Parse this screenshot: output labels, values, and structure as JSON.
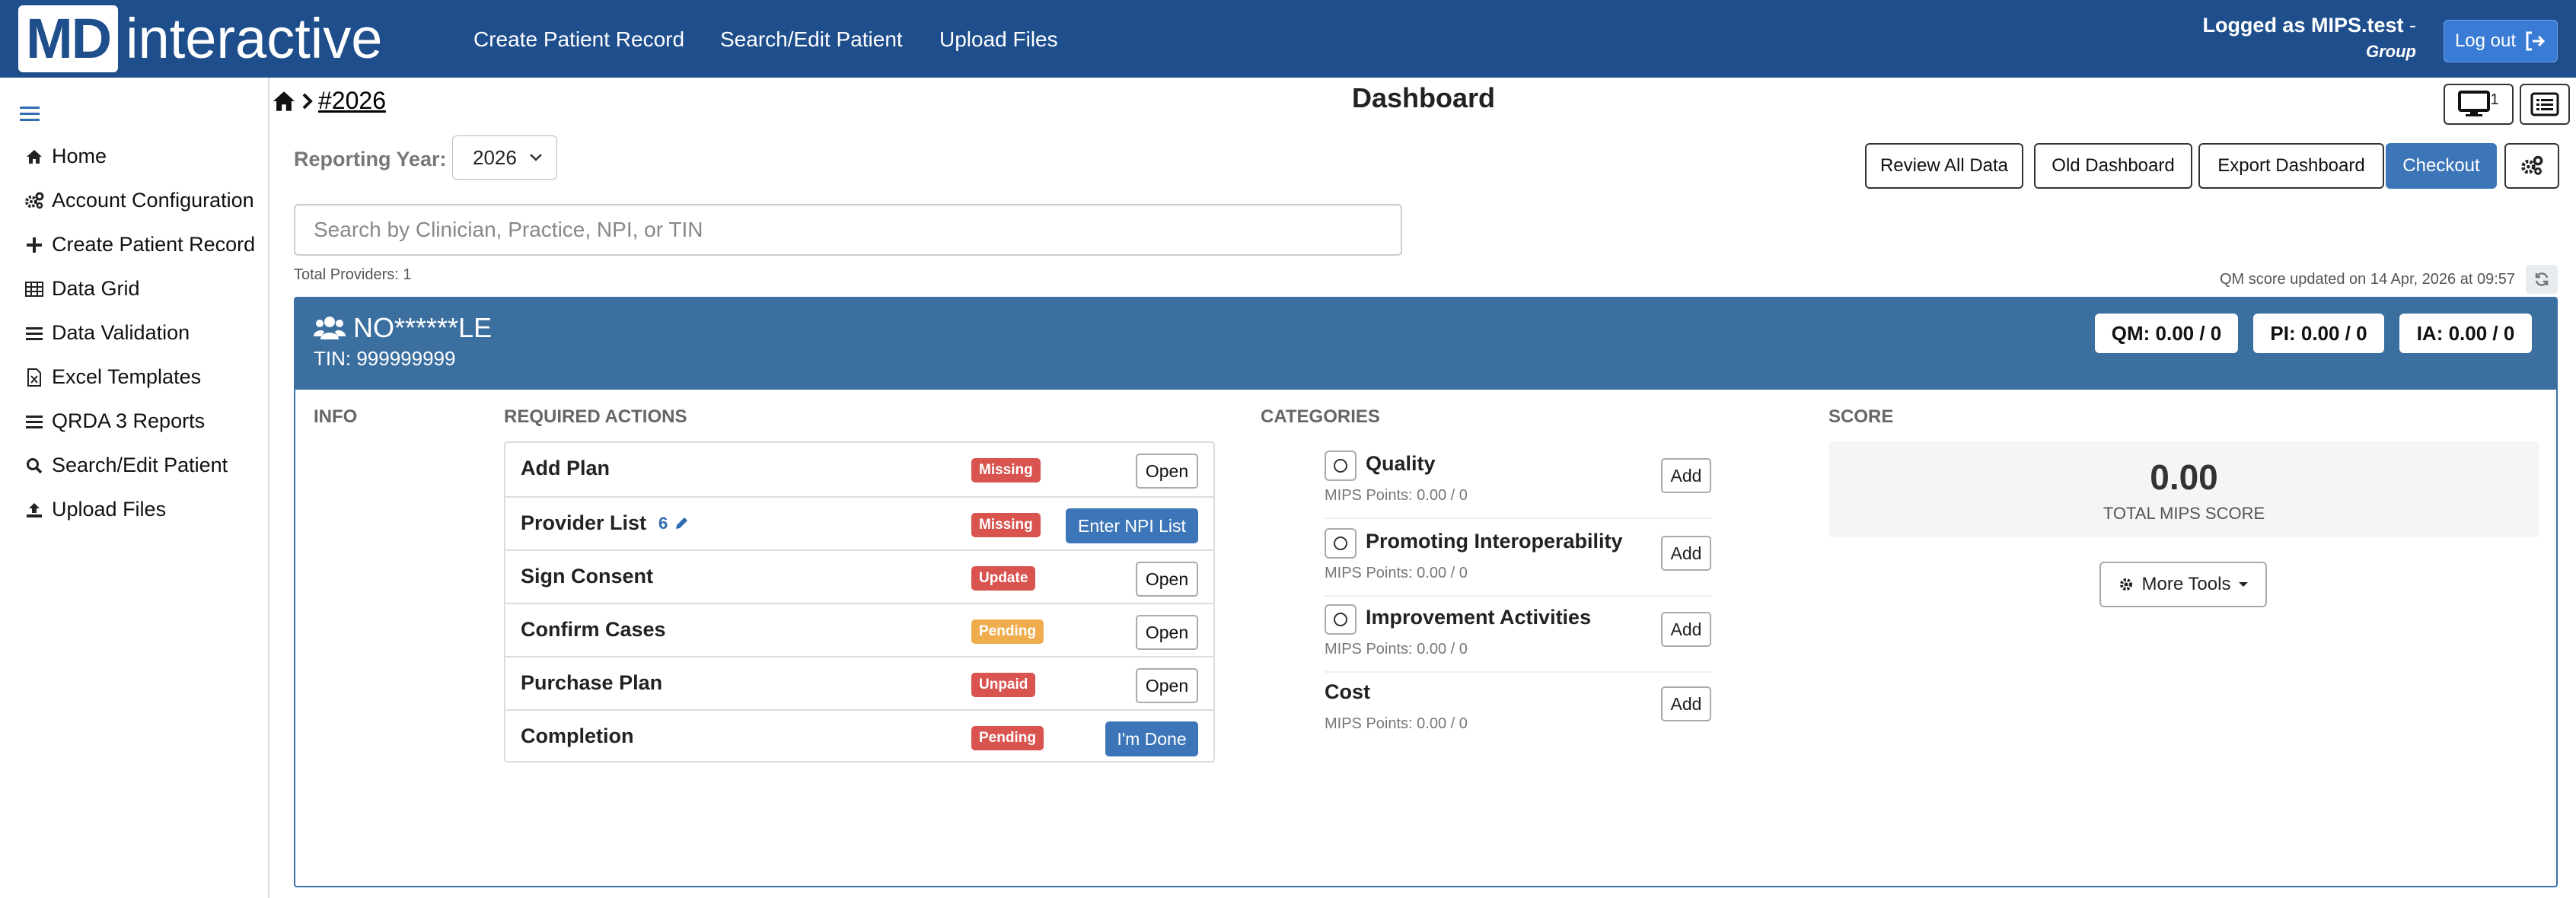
{
  "brand": {
    "md": "MD",
    "rest": "interactive"
  },
  "nav": {
    "links": [
      "Create Patient Record",
      "Search/Edit Patient",
      "Upload Files"
    ],
    "login_line": "Logged as MIPS.test",
    "login_dash": " -",
    "login_role": "Group",
    "logout_label": "Log out"
  },
  "sidebar": {
    "items": [
      {
        "label": "Home",
        "icon": "home-icon"
      },
      {
        "label": "Account Configuration",
        "icon": "gears-icon"
      },
      {
        "label": "Create Patient Record",
        "icon": "plus-icon"
      },
      {
        "label": "Data Grid",
        "icon": "table-icon"
      },
      {
        "label": "Data Validation",
        "icon": "list-icon"
      },
      {
        "label": "Excel Templates",
        "icon": "excel-file-icon"
      },
      {
        "label": "QRDA 3 Reports",
        "icon": "list-icon"
      },
      {
        "label": "Search/Edit Patient",
        "icon": "search-icon"
      },
      {
        "label": "Upload Files",
        "icon": "upload-icon"
      }
    ]
  },
  "breadcrumb": {
    "current": "#2026"
  },
  "page": {
    "title": "Dashboard",
    "monitor_count": "1"
  },
  "reporting": {
    "label": "Reporting Year:",
    "year": "2026"
  },
  "actions": {
    "review": "Review All Data",
    "old_dashboard": "Old Dashboard",
    "export": "Export Dashboard",
    "checkout": "Checkout"
  },
  "search": {
    "placeholder": "Search by Clinician, Practice, NPI, or TIN"
  },
  "total_providers": "Total Providers: 1",
  "qm_updated": "QM score updated on 14 Apr, 2026 at 09:57",
  "group": {
    "name": "NO******LE",
    "tin": "TIN: 999999999",
    "qm": "QM: 0.00 / 0",
    "pi": "PI: 0.00 / 0",
    "ia": "IA: 0.00 / 0"
  },
  "columns": {
    "info": "INFO",
    "required": "REQUIRED ACTIONS",
    "categories": "CATEGORIES",
    "score": "SCORE"
  },
  "required_actions": [
    {
      "name": "Add Plan",
      "status": "Missing",
      "status_color": "#d9534f",
      "button": "Open",
      "count": ""
    },
    {
      "name": "Provider List",
      "status": "Missing",
      "status_color": "#d9534f",
      "button": "Enter NPI List",
      "count": "6"
    },
    {
      "name": "Sign Consent",
      "status": "Update",
      "status_color": "#d9534f",
      "button": "Open",
      "count": ""
    },
    {
      "name": "Confirm Cases",
      "status": "Pending",
      "status_color": "#f0ad4e",
      "button": "Open",
      "count": ""
    },
    {
      "name": "Purchase Plan",
      "status": "Unpaid",
      "status_color": "#d9534f",
      "button": "Open",
      "count": ""
    },
    {
      "name": "Completion",
      "status": "Pending",
      "status_color": "#d9534f",
      "button": "I'm Done",
      "count": ""
    }
  ],
  "categories": [
    {
      "name": "Quality",
      "points": "MIPS Points: 0.00 / 0",
      "button": "Add"
    },
    {
      "name": "Promoting Interoperability",
      "points": "MIPS Points: 0.00 / 0",
      "button": "Add"
    },
    {
      "name": "Improvement Activities",
      "points": "MIPS Points: 0.00 / 0",
      "button": "Add"
    },
    {
      "name": "Cost",
      "points": "MIPS Points: 0.00 / 0",
      "button": "Add"
    }
  ],
  "score": {
    "value": "0.00",
    "label": "TOTAL MIPS SCORE",
    "more_tools": "More Tools"
  },
  "colors": {
    "nav": "#1f4e8c",
    "card_header": "#3b6fa0",
    "primary_button": "#3c76b8",
    "missing": "#d9534f",
    "pending": "#f0ad4e"
  }
}
